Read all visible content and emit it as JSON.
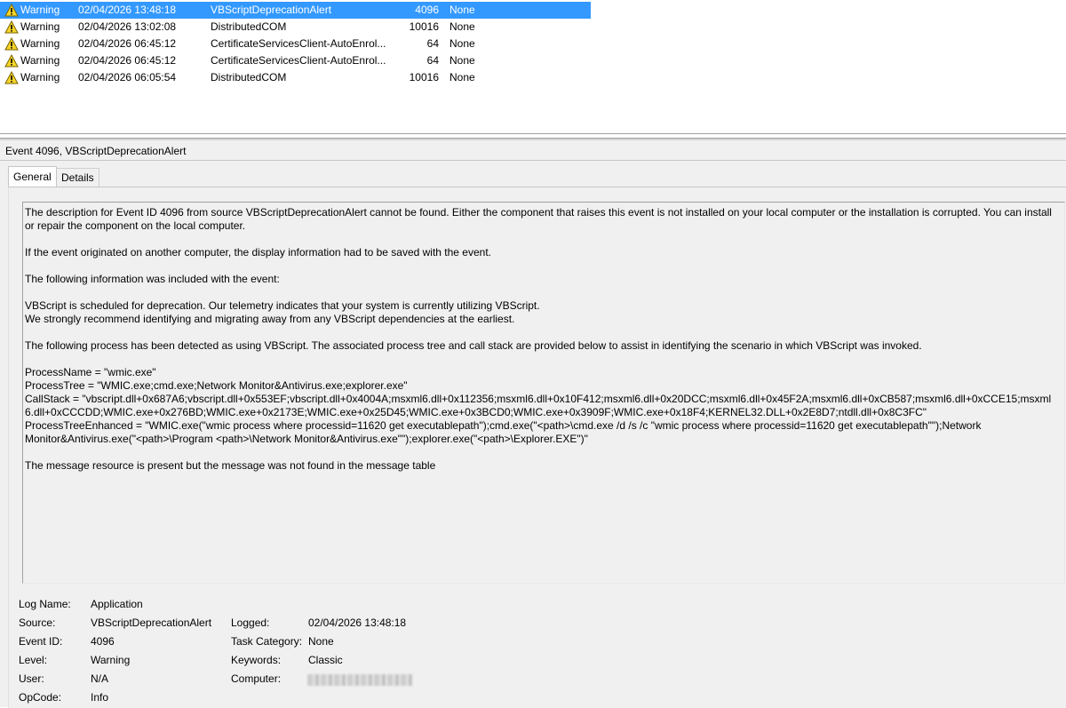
{
  "events": [
    {
      "level": "Warning",
      "date": "02/04/2026 13:48:18",
      "source": "VBScriptDeprecationAlert",
      "event_id": "4096",
      "task": "None",
      "selected": true
    },
    {
      "level": "Warning",
      "date": "02/04/2026 13:02:08",
      "source": "DistributedCOM",
      "event_id": "10016",
      "task": "None",
      "selected": false
    },
    {
      "level": "Warning",
      "date": "02/04/2026 06:45:12",
      "source": "CertificateServicesClient-AutoEnrol...",
      "event_id": "64",
      "task": "None",
      "selected": false
    },
    {
      "level": "Warning",
      "date": "02/04/2026 06:45:12",
      "source": "CertificateServicesClient-AutoEnrol...",
      "event_id": "64",
      "task": "None",
      "selected": false
    },
    {
      "level": "Warning",
      "date": "02/04/2026 06:05:54",
      "source": "DistributedCOM",
      "event_id": "10016",
      "task": "None",
      "selected": false
    }
  ],
  "detail": {
    "title": "Event 4096, VBScriptDeprecationAlert",
    "tabs": {
      "general": "General",
      "details": "Details"
    },
    "description": {
      "p1": "The description for Event ID 4096 from source VBScriptDeprecationAlert cannot be found. Either the component that raises this event is not installed on your local computer or the installation is corrupted. You can install or repair the component on the local computer.",
      "p2": "If the event originated on another computer, the display information had to be saved with the event.",
      "p3": "The following information was included with the event:",
      "p4_line1": "VBScript is scheduled for deprecation. Our telemetry indicates that your system is currently utilizing VBScript.",
      "p4_line2": "We strongly recommend identifying and migrating away from any VBScript dependencies at the earliest.",
      "p5": "The following process has been detected as using VBScript. The associated process tree and call stack are provided below to assist in identifying the scenario in which VBScript was invoked.",
      "process_name": "ProcessName = \"wmic.exe\"",
      "process_tree": "ProcessTree = \"WMIC.exe;cmd.exe;Network Monitor&Antivirus.exe;explorer.exe\"",
      "call_stack": "CallStack = \"vbscript.dll+0x687A6;vbscript.dll+0x553EF;vbscript.dll+0x4004A;msxml6.dll+0x112356;msxml6.dll+0x10F412;msxml6.dll+0x20DCC;msxml6.dll+0x45F2A;msxml6.dll+0xCB587;msxml6.dll+0xCCE15;msxml6.dll+0xCCCDD;WMIC.exe+0x276BD;WMIC.exe+0x2173E;WMIC.exe+0x25D45;WMIC.exe+0x3BCD0;WMIC.exe+0x3909F;WMIC.exe+0x18F4;KERNEL32.DLL+0x2E8D7;ntdll.dll+0x8C3FC\"",
      "process_tree_enhanced": "ProcessTreeEnhanced = \"WMIC.exe(\"wmic process where processid=11620 get executablepath\");cmd.exe(\"<path>\\cmd.exe /d /s /c \"wmic process where processid=11620 get executablepath\"\");Network Monitor&Antivirus.exe(\"<path>\\Program <path>\\Network Monitor&Antivirus.exe\"\");explorer.exe(\"<path>\\Explorer.EXE\")\"",
      "p_last": "The message resource is present but the message was not found in the message table"
    },
    "properties": {
      "log_name_label": "Log Name:",
      "log_name": "Application",
      "source_label": "Source:",
      "source": "VBScriptDeprecationAlert",
      "logged_label": "Logged:",
      "logged": "02/04/2026 13:48:18",
      "event_id_label": "Event ID:",
      "event_id": "4096",
      "task_category_label": "Task Category:",
      "task_category": "None",
      "level_label": "Level:",
      "level": "Warning",
      "keywords_label": "Keywords:",
      "keywords": "Classic",
      "user_label": "User:",
      "user": "N/A",
      "computer_label": "Computer:",
      "opcode_label": "OpCode:",
      "opcode": "Info"
    }
  }
}
